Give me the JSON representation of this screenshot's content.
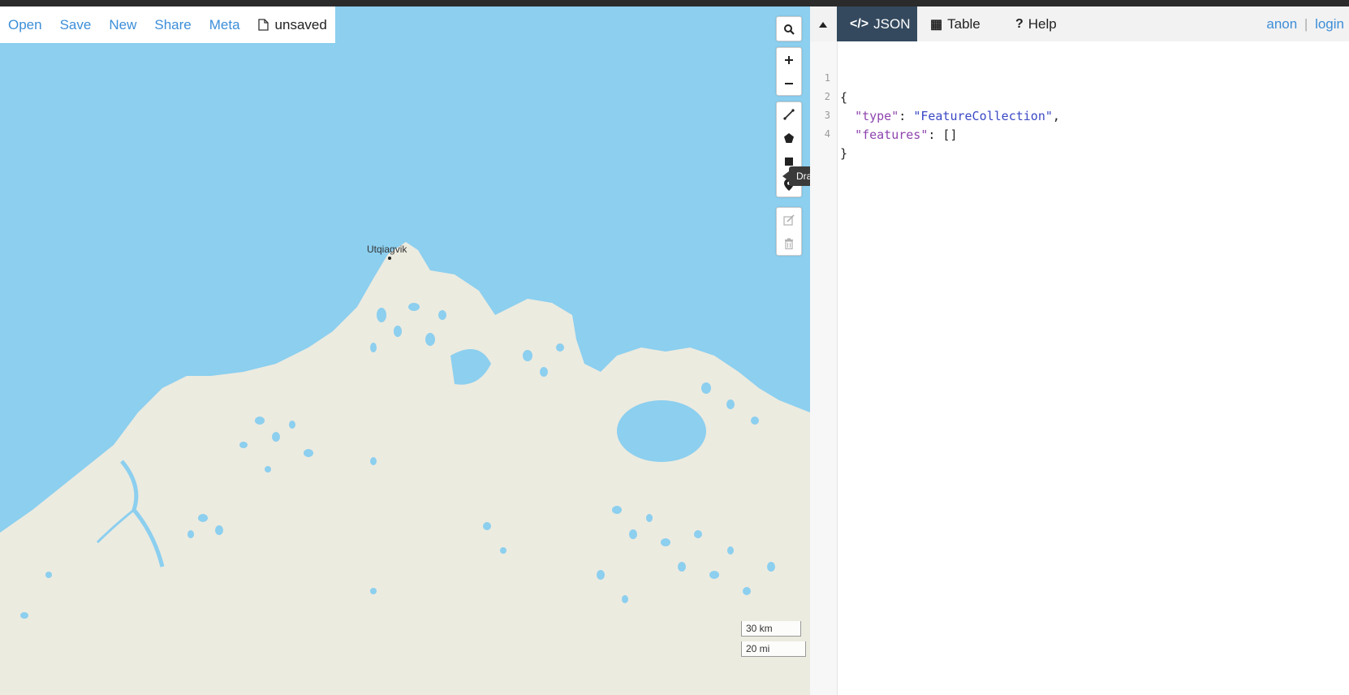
{
  "file_menu": {
    "items": [
      "Open",
      "Save",
      "New",
      "Share",
      "Meta"
    ],
    "doc_icon": "file-icon",
    "doc_name": "unsaved"
  },
  "map": {
    "place_label": "Utqiagvik",
    "tooltip": "Draw a polygon",
    "scale_km": "30 km",
    "scale_mi": "20 mi",
    "controls": [
      "search-icon",
      "zoom-in-icon",
      "zoom-out-icon",
      "draw-line-icon",
      "draw-polygon-icon",
      "draw-rectangle-icon",
      "draw-marker-icon",
      "edit-layers-icon",
      "delete-layers-icon"
    ],
    "colors": {
      "water": "#8ccfef",
      "land": "#ecebe0"
    }
  },
  "pane": {
    "tabs": [
      {
        "icon": "</>",
        "label": "JSON",
        "active": true
      },
      {
        "icon": "▦",
        "label": "Table",
        "active": false
      },
      {
        "icon": "?",
        "label": "Help",
        "active": false
      }
    ],
    "auth": {
      "anon": "anon",
      "separator": "|",
      "login": "login"
    },
    "accent": "#34495e"
  },
  "editor": {
    "line_numbers": [
      "1",
      "2",
      "3",
      "4"
    ],
    "l1": "{",
    "l2_key": "\"type\"",
    "l2_colon": ": ",
    "l2_val": "\"FeatureCollection\"",
    "l2_comma": ",",
    "l3_key": "\"features\"",
    "l3_rest": ": []",
    "l4": "}"
  }
}
